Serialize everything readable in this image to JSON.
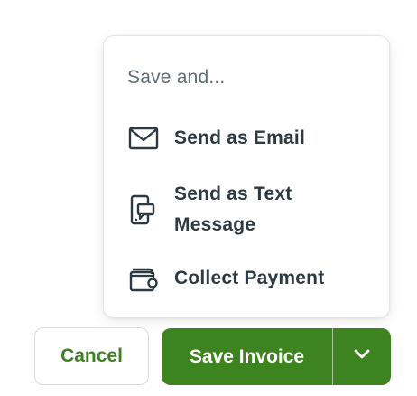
{
  "menu": {
    "header": "Save and...",
    "items": [
      {
        "label": "Send as Email",
        "icon": "envelope-icon"
      },
      {
        "label": "Send as Text Message",
        "label_line1": "Send as Text",
        "label_line2": "Message",
        "icon": "phone-message-icon"
      },
      {
        "label": "Collect Payment",
        "icon": "wallet-icon"
      }
    ]
  },
  "actions": {
    "cancel_label": "Cancel",
    "save_label": "Save Invoice",
    "toggle_icon": "chevron-down-icon"
  },
  "colors": {
    "primary": "#3d8420",
    "cancel_text": "#3f7f25",
    "menu_text": "#2d3a42",
    "header_text": "#5f6c73"
  }
}
